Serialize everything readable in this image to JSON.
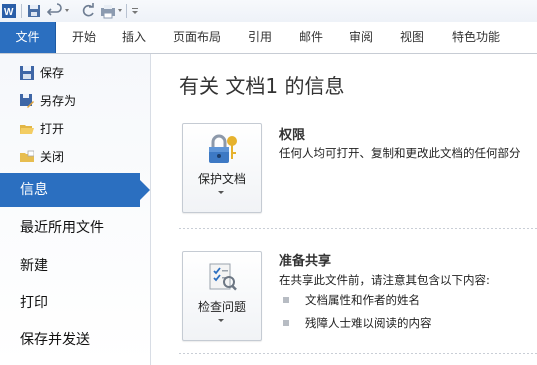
{
  "ribbon": {
    "file_tab": "文件",
    "tabs": [
      "开始",
      "插入",
      "页面布局",
      "引用",
      "邮件",
      "审阅",
      "视图",
      "特色功能"
    ]
  },
  "backstage": {
    "commands": [
      {
        "label": "保存",
        "icon": "save-icon"
      },
      {
        "label": "另存为",
        "icon": "save-as-icon"
      },
      {
        "label": "打开",
        "icon": "open-folder-icon"
      },
      {
        "label": "关闭",
        "icon": "close-folder-icon"
      }
    ],
    "nav": [
      "信息",
      "最近所用文件",
      "新建",
      "打印",
      "保存并发送"
    ],
    "selected": "信息"
  },
  "info": {
    "title": "有关 文档1 的信息",
    "permissions": {
      "button_label": "保护文档",
      "heading": "权限",
      "text": "任何人均可打开、复制和更改此文档的任何部分"
    },
    "prepare": {
      "button_label": "检查问题",
      "heading": "准备共享",
      "text": "在共享此文件前，请注意其包含以下内容:",
      "bullets": [
        "文档属性和作者的姓名",
        "残障人士难以阅读的内容"
      ]
    }
  },
  "colors": {
    "accent": "#2b6fc0"
  }
}
